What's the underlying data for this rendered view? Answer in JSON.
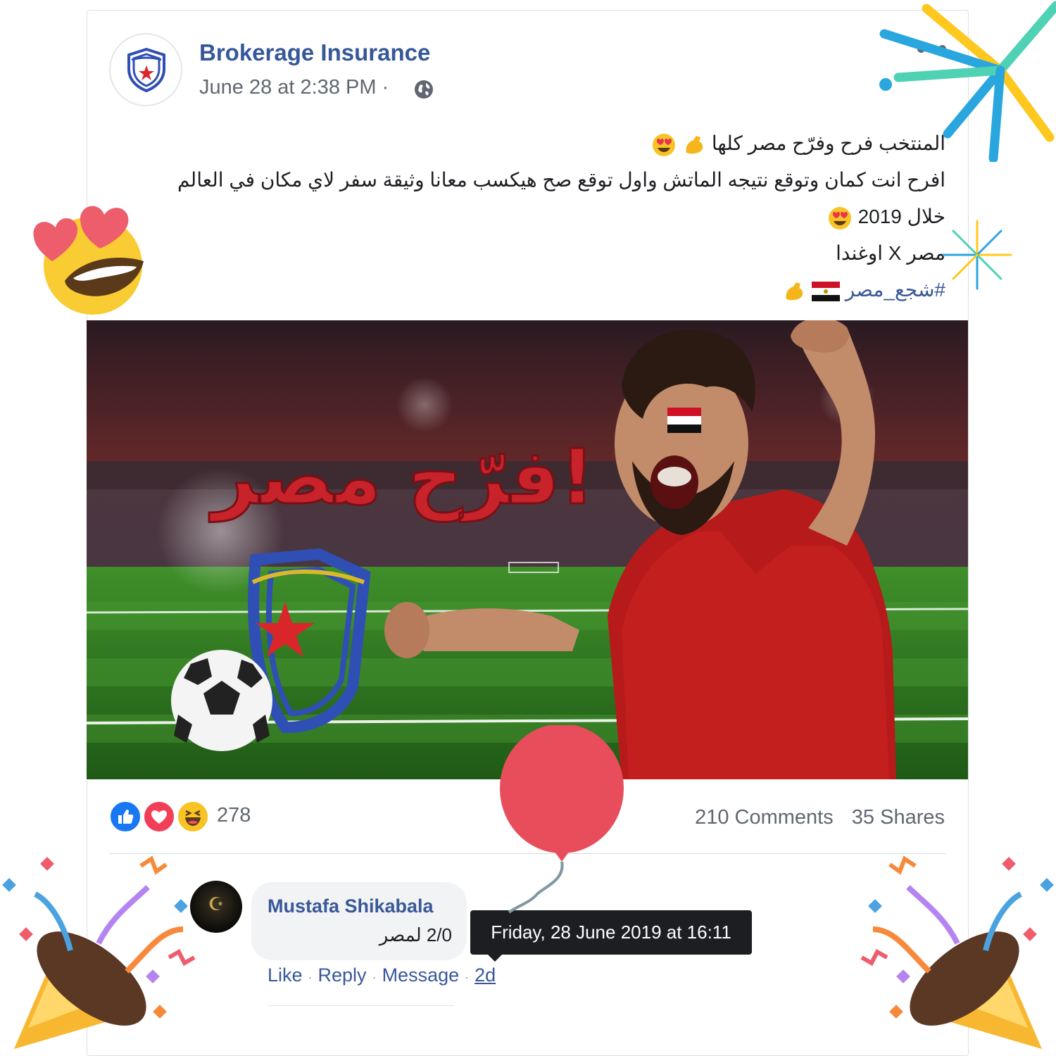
{
  "post": {
    "page_name": "Brokerage Insurance",
    "timestamp": "June 28 at 2:38 PM ·",
    "text": {
      "line1": "المنتخب فرح وفرّح مصر كلها",
      "line2": "افرح انت كمان وتوقع نتيجه الماتش واول توقع صح هيكسب معانا وثيقة سفر لاي مكان في العالم",
      "line3": "خلال 2019",
      "line4": "مصر X اوغندا",
      "hashtag": "#شجع_مصر"
    },
    "image_caption": "فرّح مصر!"
  },
  "stats": {
    "reaction_count": "278",
    "comments": "210 Comments",
    "shares": "35 Shares",
    "reaction_icons": [
      "like-icon",
      "love-icon",
      "haha-icon"
    ]
  },
  "comment": {
    "author": "Mustafa Shikabala",
    "text": "2/0 لمصر",
    "actions": {
      "like": "Like",
      "reply": "Reply",
      "message": "Message",
      "time": "2d"
    },
    "tooltip": "Friday, 28 June 2019 at 16:11"
  },
  "colors": {
    "link_blue": "#385898",
    "name_blue": "#365899",
    "balloon": "#e84d5b",
    "like_blue": "#1877f2",
    "love_red": "#f33e58"
  }
}
